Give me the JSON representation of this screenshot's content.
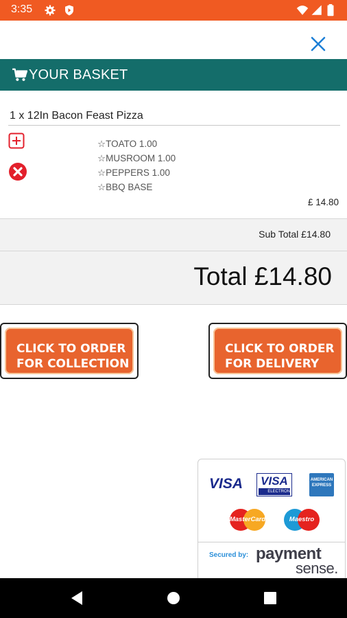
{
  "status_bar": {
    "time": "3:35"
  },
  "header": {
    "title": "YOUR BASKET"
  },
  "basket": {
    "item_name": "1 x 12In Bacon Feast Pizza",
    "options": [
      "☆TOATO 1.00",
      "☆MUSROOM 1.00",
      "☆PEPPERS 1.00",
      "☆BBQ BASE"
    ],
    "item_price": "£ 14.80"
  },
  "subtotal": "Sub Total £14.80",
  "total": "Total £14.80",
  "buttons": {
    "collection_line1": "CLICK TO ORDER",
    "collection_line2": "FOR COLLECTION",
    "delivery_line1": "CLICK TO ORDER",
    "delivery_line2": "FOR DELIVERY"
  },
  "payment": {
    "visa": "VISA",
    "visa_electron": "VISA",
    "visa_electron_sub": "ELECTRON",
    "amex": "AMERICAN EXPRESS",
    "mastercard": "MasterCard",
    "maestro": "Maestro",
    "secured_by": "Secured by:",
    "brand_1": "payment",
    "brand_2": "sense."
  },
  "icons": [
    "settings-icon",
    "shield-icon",
    "wifi-icon",
    "signal-icon",
    "battery-icon",
    "close-icon",
    "cart-icon",
    "add-icon",
    "remove-icon",
    "back-icon",
    "home-icon",
    "recents-icon"
  ],
  "colors": {
    "status_bar": "#f05a22",
    "header_bg": "#146d6a",
    "button_orange": "#e8642e",
    "close_blue": "#1e7fd6",
    "remove_red": "#e3202c"
  }
}
